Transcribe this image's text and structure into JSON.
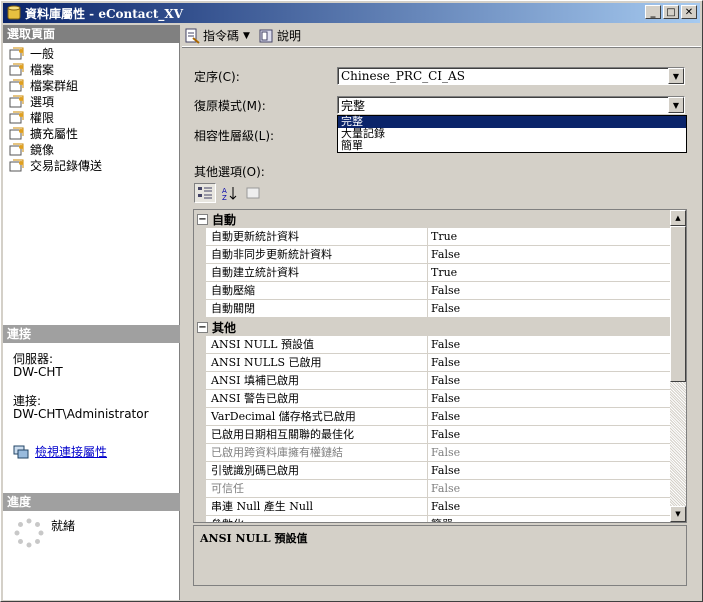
{
  "window": {
    "title": "資料庫屬性 - eContact_XV"
  },
  "left": {
    "select_page_header": "選取頁面",
    "pages": [
      {
        "label": "一般"
      },
      {
        "label": "檔案"
      },
      {
        "label": "檔案群組"
      },
      {
        "label": "選項"
      },
      {
        "label": "權限"
      },
      {
        "label": "擴充屬性"
      },
      {
        "label": "鏡像"
      },
      {
        "label": "交易記錄傳送"
      }
    ],
    "connection_header": "連接",
    "server_label": "伺服器:",
    "server_value": "DW-CHT",
    "connection_label": "連接:",
    "connection_value": "DW-CHT\\Administrator",
    "view_props_link": "檢視連接屬性",
    "progress_header": "進度",
    "progress_status": "就緒"
  },
  "toolbar": {
    "script_label": "指令碼",
    "help_label": "說明"
  },
  "form": {
    "collation_label": "定序(C):",
    "collation_value": "Chinese_PRC_CI_AS",
    "recovery_label": "復原模式(M):",
    "recovery_value": "完整",
    "compat_label": "相容性層級(L):",
    "recovery_options": [
      "完整",
      "大量記錄",
      "簡單"
    ],
    "other_options_label": "其他選項(O):"
  },
  "grid": {
    "categories": [
      {
        "name": "自動",
        "rows": [
          {
            "name": "自動更新統計資料",
            "value": "True"
          },
          {
            "name": "自動非同步更新統計資料",
            "value": "False"
          },
          {
            "name": "自動建立統計資料",
            "value": "True"
          },
          {
            "name": "自動壓縮",
            "value": "False"
          },
          {
            "name": "自動關閉",
            "value": "False"
          }
        ]
      },
      {
        "name": "其他",
        "rows": [
          {
            "name": "ANSI NULL 預設值",
            "value": "False"
          },
          {
            "name": "ANSI NULLS 已啟用",
            "value": "False"
          },
          {
            "name": "ANSI 填補已啟用",
            "value": "False"
          },
          {
            "name": "ANSI 警告已啟用",
            "value": "False"
          },
          {
            "name": "VarDecimal 儲存格式已啟用",
            "value": "False"
          },
          {
            "name": "已啟用日期相互關聯的最佳化",
            "value": "False"
          },
          {
            "name": "已啟用跨資料庫擁有權鏈結",
            "value": "False",
            "disabled": true
          },
          {
            "name": "引號識別碼已啟用",
            "value": "False"
          },
          {
            "name": "可信任",
            "value": "False",
            "disabled": true
          },
          {
            "name": "串連 Null 產生 Null",
            "value": "False"
          },
          {
            "name": "參數化",
            "value": "簡單"
          }
        ]
      }
    ]
  },
  "description": {
    "title": "ANSI NULL 預設值"
  }
}
